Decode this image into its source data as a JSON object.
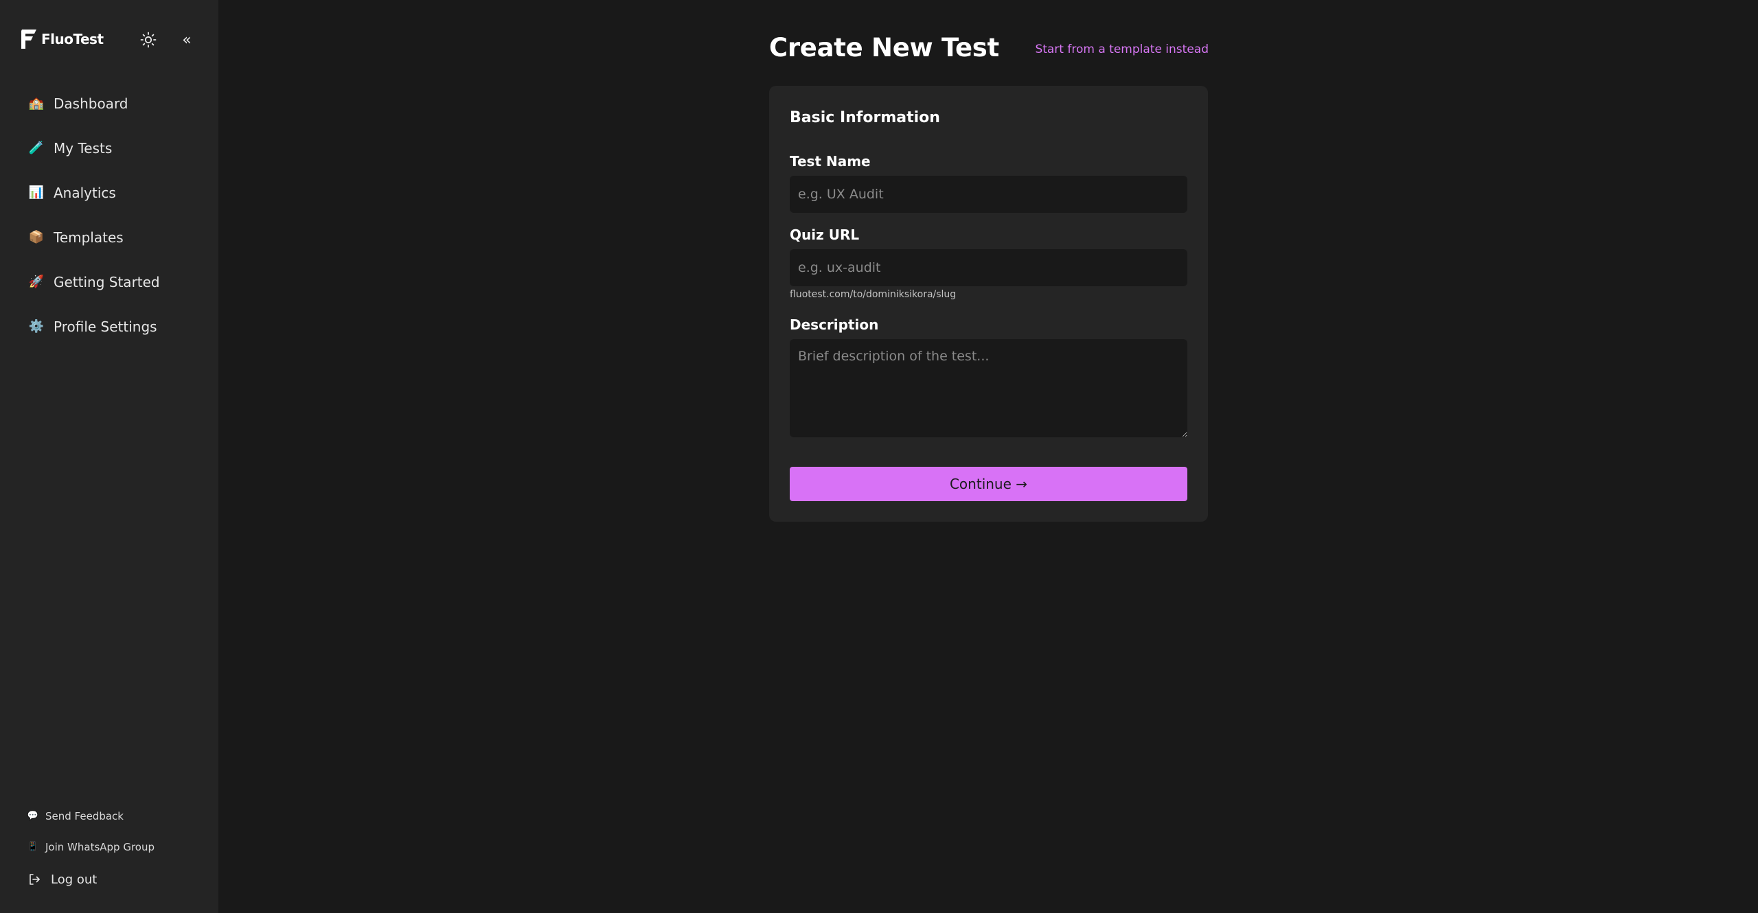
{
  "app": {
    "name": "FluoTest"
  },
  "sidebar": {
    "theme_icon": "sun-icon",
    "collapse_label": "«",
    "items": [
      {
        "label": "Dashboard",
        "icon": "🏫"
      },
      {
        "label": "My Tests",
        "icon": "🧪"
      },
      {
        "label": "Analytics",
        "icon": "📊"
      },
      {
        "label": "Templates",
        "icon": "📦"
      },
      {
        "label": "Getting Started",
        "icon": "🚀"
      },
      {
        "label": "Profile Settings",
        "icon": "⚙️"
      }
    ],
    "bottom_links": [
      {
        "label": "Send Feedback",
        "icon": "💬"
      },
      {
        "label": "Join WhatsApp Group",
        "icon": "📱"
      }
    ],
    "logout_label": "Log out"
  },
  "main": {
    "title": "Create New Test",
    "template_link": "Start from a template instead",
    "card": {
      "title": "Basic Information",
      "test_name": {
        "label": "Test Name",
        "placeholder": "e.g. UX Audit",
        "value": ""
      },
      "quiz_url": {
        "label": "Quiz URL",
        "placeholder": "e.g. ux-audit",
        "value": "",
        "helper": "fluotest.com/to/dominiksikora/slug"
      },
      "description": {
        "label": "Description",
        "placeholder": "Brief description of the test...",
        "value": ""
      },
      "continue_label": "Continue →"
    }
  },
  "colors": {
    "accent": "#d872f6",
    "link": "#d877f5",
    "background": "#191919",
    "sidebar": "#242424",
    "card": "#252525"
  }
}
